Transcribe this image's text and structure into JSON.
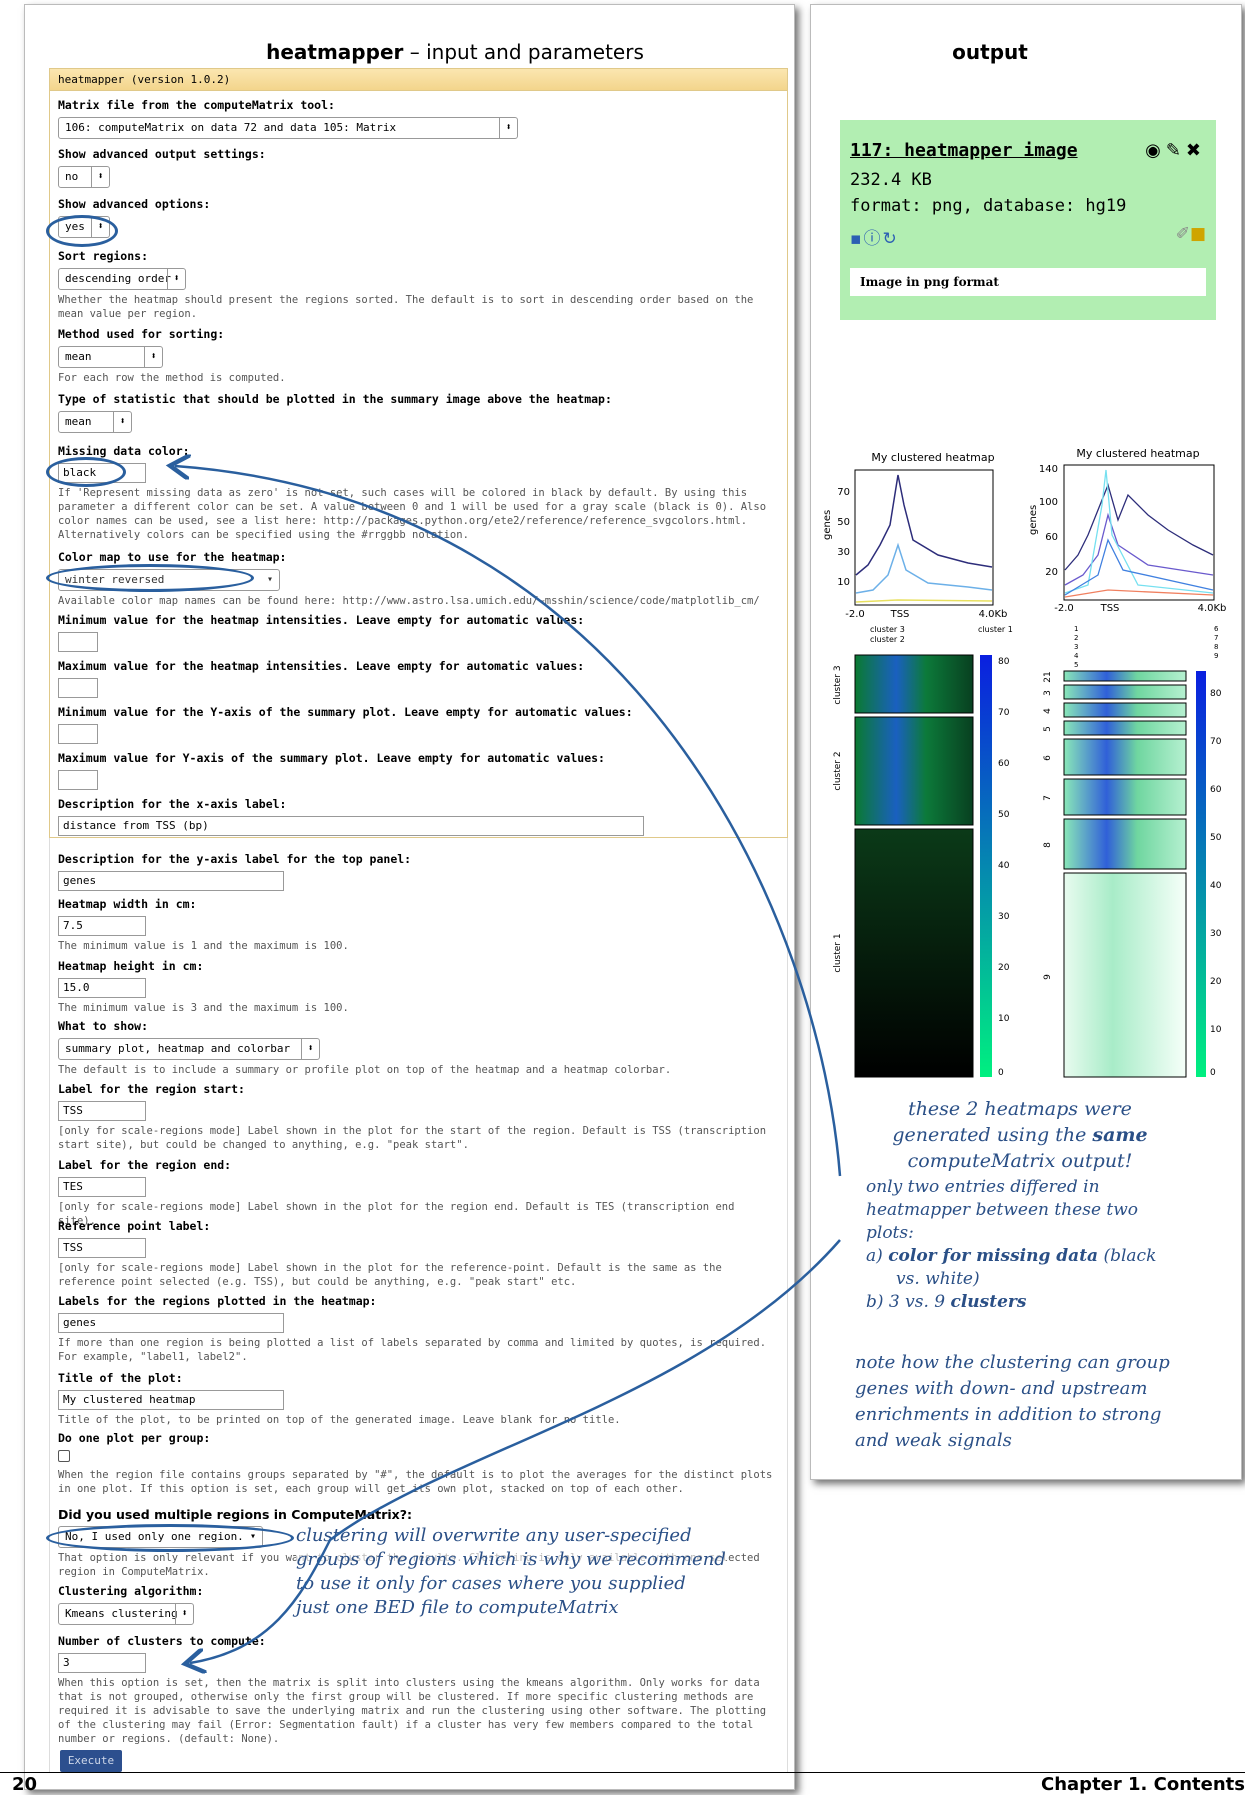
{
  "left_title_tool": "heatmapper",
  "left_title_rest": " – input and parameters",
  "right_title": "output",
  "tool_header": "heatmapper (version 1.0.2)",
  "fields": {
    "matrix_label": "Matrix file from the computeMatrix tool:",
    "matrix_value": "106: computeMatrix on data 72 and data 105: Matrix",
    "adv_output_label": "Show advanced output settings:",
    "adv_output_value": "no",
    "adv_options_label": "Show advanced options:",
    "adv_options_value": "yes",
    "sort_label": "Sort regions:",
    "sort_value": "descending order",
    "sort_help": "Whether the heatmap should present the regions sorted. The default is to sort in descending order based on the mean value per region.",
    "method_label": "Method used for sorting:",
    "method_value": "mean",
    "method_help": "For each row the method is computed.",
    "stat_label": "Type of statistic that should be plotted in the summary image above the heatmap:",
    "stat_value": "mean",
    "missing_label": "Missing data color:",
    "missing_value": "black",
    "missing_help": "If 'Represent missing data as zero' is not set, such cases will be colored in black by default. By using this parameter a different color can be set. A value between 0 and 1 will be used for a gray scale (black is 0). Also color names can be used, see a list here: http://packages.python.org/ete2/reference/reference_svgcolors.html. Alternatively colors can be specified using the #rrggbb notation.",
    "cmap_label": "Color map to use for the heatmap:",
    "cmap_value": "winter reversed",
    "cmap_help": "Available color map names can be found here: http://www.astro.lsa.umich.edu/~msshin/science/code/matplotlib_cm/",
    "zmin_label": "Minimum value for the heatmap intensities. Leave empty for automatic values:",
    "zmax_label": "Maximum value for the heatmap intensities. Leave empty for automatic values:",
    "ymin_label": "Minimum value for the Y-axis of the summary plot. Leave empty for automatic values:",
    "ymax_label": "Maximum value for Y-axis of the summary plot. Leave empty for automatic values:",
    "xlabel_label": "Description for the x-axis label:",
    "xlabel_value": "distance from TSS (bp)",
    "ylabel_label": "Description for the y-axis label for the top panel:",
    "ylabel_value": "genes",
    "width_label": "Heatmap width in cm:",
    "width_value": "7.5",
    "width_help": "The minimum value is 1 and the maximum is 100.",
    "height_label": "Heatmap height in cm:",
    "height_value": "15.0",
    "height_help": "The minimum value is 3 and the maximum is 100.",
    "show_label": "What to show:",
    "show_value": "summary plot, heatmap and colorbar",
    "show_help": "The default is to include a summary or profile plot on top of the heatmap and a heatmap colorbar.",
    "start_label": "Label for the region start:",
    "start_value": "TSS",
    "start_help": "[only for scale-regions mode] Label shown in the plot for the start of the region. Default is TSS (transcription start site), but could be changed to anything, e.g. \"peak start\".",
    "end_label": "Label for the region end:",
    "end_value": "TES",
    "end_help": "[only for scale-regions mode] Label shown in the plot for the region end. Default is TES (transcription end site).",
    "ref_label": "Reference point label:",
    "ref_value": "TSS",
    "ref_help": "[only for scale-regions mode] Label shown in the plot for the reference-point. Default is the same as the reference point selected (e.g. TSS), but could be anything, e.g. \"peak start\" etc.",
    "regions_label": "Labels for the regions plotted in the heatmap:",
    "regions_value": "genes",
    "regions_help": "If more than one region is being plotted a list of labels separated by comma and limited by quotes, is required. For example, \"label1, label2\".",
    "title_label": "Title of the plot:",
    "title_value": "My clustered heatmap",
    "title_help": "Title of the plot, to be printed on top of the generated image. Leave blank for no title.",
    "onepergroup_label": "Do one plot per group:",
    "onepergroup_help": "When the region file contains groups separated by \"#\", the default is to plot the averages for the distinct plots in one plot. If this option is set, each group will get its own plot, stacked on top of each other.",
    "multi_label": "Did you used multiple regions in ComputeMatrix?:",
    "multi_value": "No, I used only one region.",
    "multi_help": "That option is only relevant if you want to cluster the results. Clustering is only available with one selected region in ComputeMatrix.",
    "algo_label": "Clustering algorithm:",
    "algo_value": "Kmeans clustering",
    "nclust_label": "Number of clusters to compute:",
    "nclust_value": "3",
    "nclust_help": "When this option is set, then the matrix is split into clusters using the kmeans algorithm. Only works for data that is not grouped, otherwise only the first group will be clustered. If more specific clustering methods are required it is advisable to save the underlying matrix and run the clustering using other software. The plotting of the clustering may fail (Error: Segmentation fault) if a cluster has very few members compared to the total number or regions. (default: None).",
    "execute_label": "Execute"
  },
  "dataset": {
    "title": "117: heatmapper image",
    "size": "232.4 KB",
    "format": "format: png, database: hg19",
    "peek": "Image in png format"
  },
  "plot_left": {
    "title": "My clustered heatmap",
    "ylabel": "genes",
    "yticks": [
      "70",
      "50",
      "30",
      "10"
    ],
    "xticks": [
      "-2.0",
      "TSS",
      "4.0Kb"
    ],
    "legend": [
      "cluster 3",
      "cluster 2",
      "cluster 1"
    ],
    "clusters": [
      "cluster 3",
      "cluster 2",
      "cluster 1"
    ],
    "cbar": [
      "80",
      "70",
      "60",
      "50",
      "40",
      "30",
      "20",
      "10",
      "0"
    ]
  },
  "plot_right": {
    "title": "My clustered heatmap",
    "ylabel": "genes",
    "yticks": [
      "140",
      "100",
      "60",
      "20"
    ],
    "xticks": [
      "-2.0",
      "TSS",
      "4.0Kb"
    ],
    "legend": [
      "1",
      "2",
      "3",
      "4",
      "5",
      "6",
      "7",
      "8",
      "9"
    ],
    "clusters": [
      "21",
      "3",
      "4",
      "5",
      "6",
      "7",
      "8",
      "9"
    ],
    "cbar": [
      "80",
      "70",
      "60",
      "50",
      "40",
      "30",
      "20",
      "10",
      "0"
    ]
  },
  "notes": {
    "n1": "these 2 heatmaps were",
    "n2": "generated using the",
    "n2b": "same",
    "n3": "computeMatrix output!",
    "n4": "only two entries differed in",
    "n5": "heatmapper between these two",
    "n6": "plots:",
    "n7a": "a)",
    "n7b": "color for missing data",
    "n7c": "(black",
    "n8": "vs. white)",
    "n9a": "b) 3 vs. 9",
    "n9b": "clusters",
    "n10": "note how the clustering can group",
    "n11": "genes with down- and upstream",
    "n12": "enrichments in addition to strong",
    "n13": "and weak signals",
    "c1": "clustering will overwrite any user-specified",
    "c2": "groups of regions which is why we recommend",
    "c3": "to use it only for cases where you supplied",
    "c4": "just one BED file to computeMatrix"
  },
  "footer": {
    "page": "20",
    "chapter": "Chapter 1.  Contents"
  },
  "colors": {
    "annotation": "#2a5f9e",
    "dataset_bg": "#b2eeb2",
    "execute": "#2c4f8e"
  }
}
